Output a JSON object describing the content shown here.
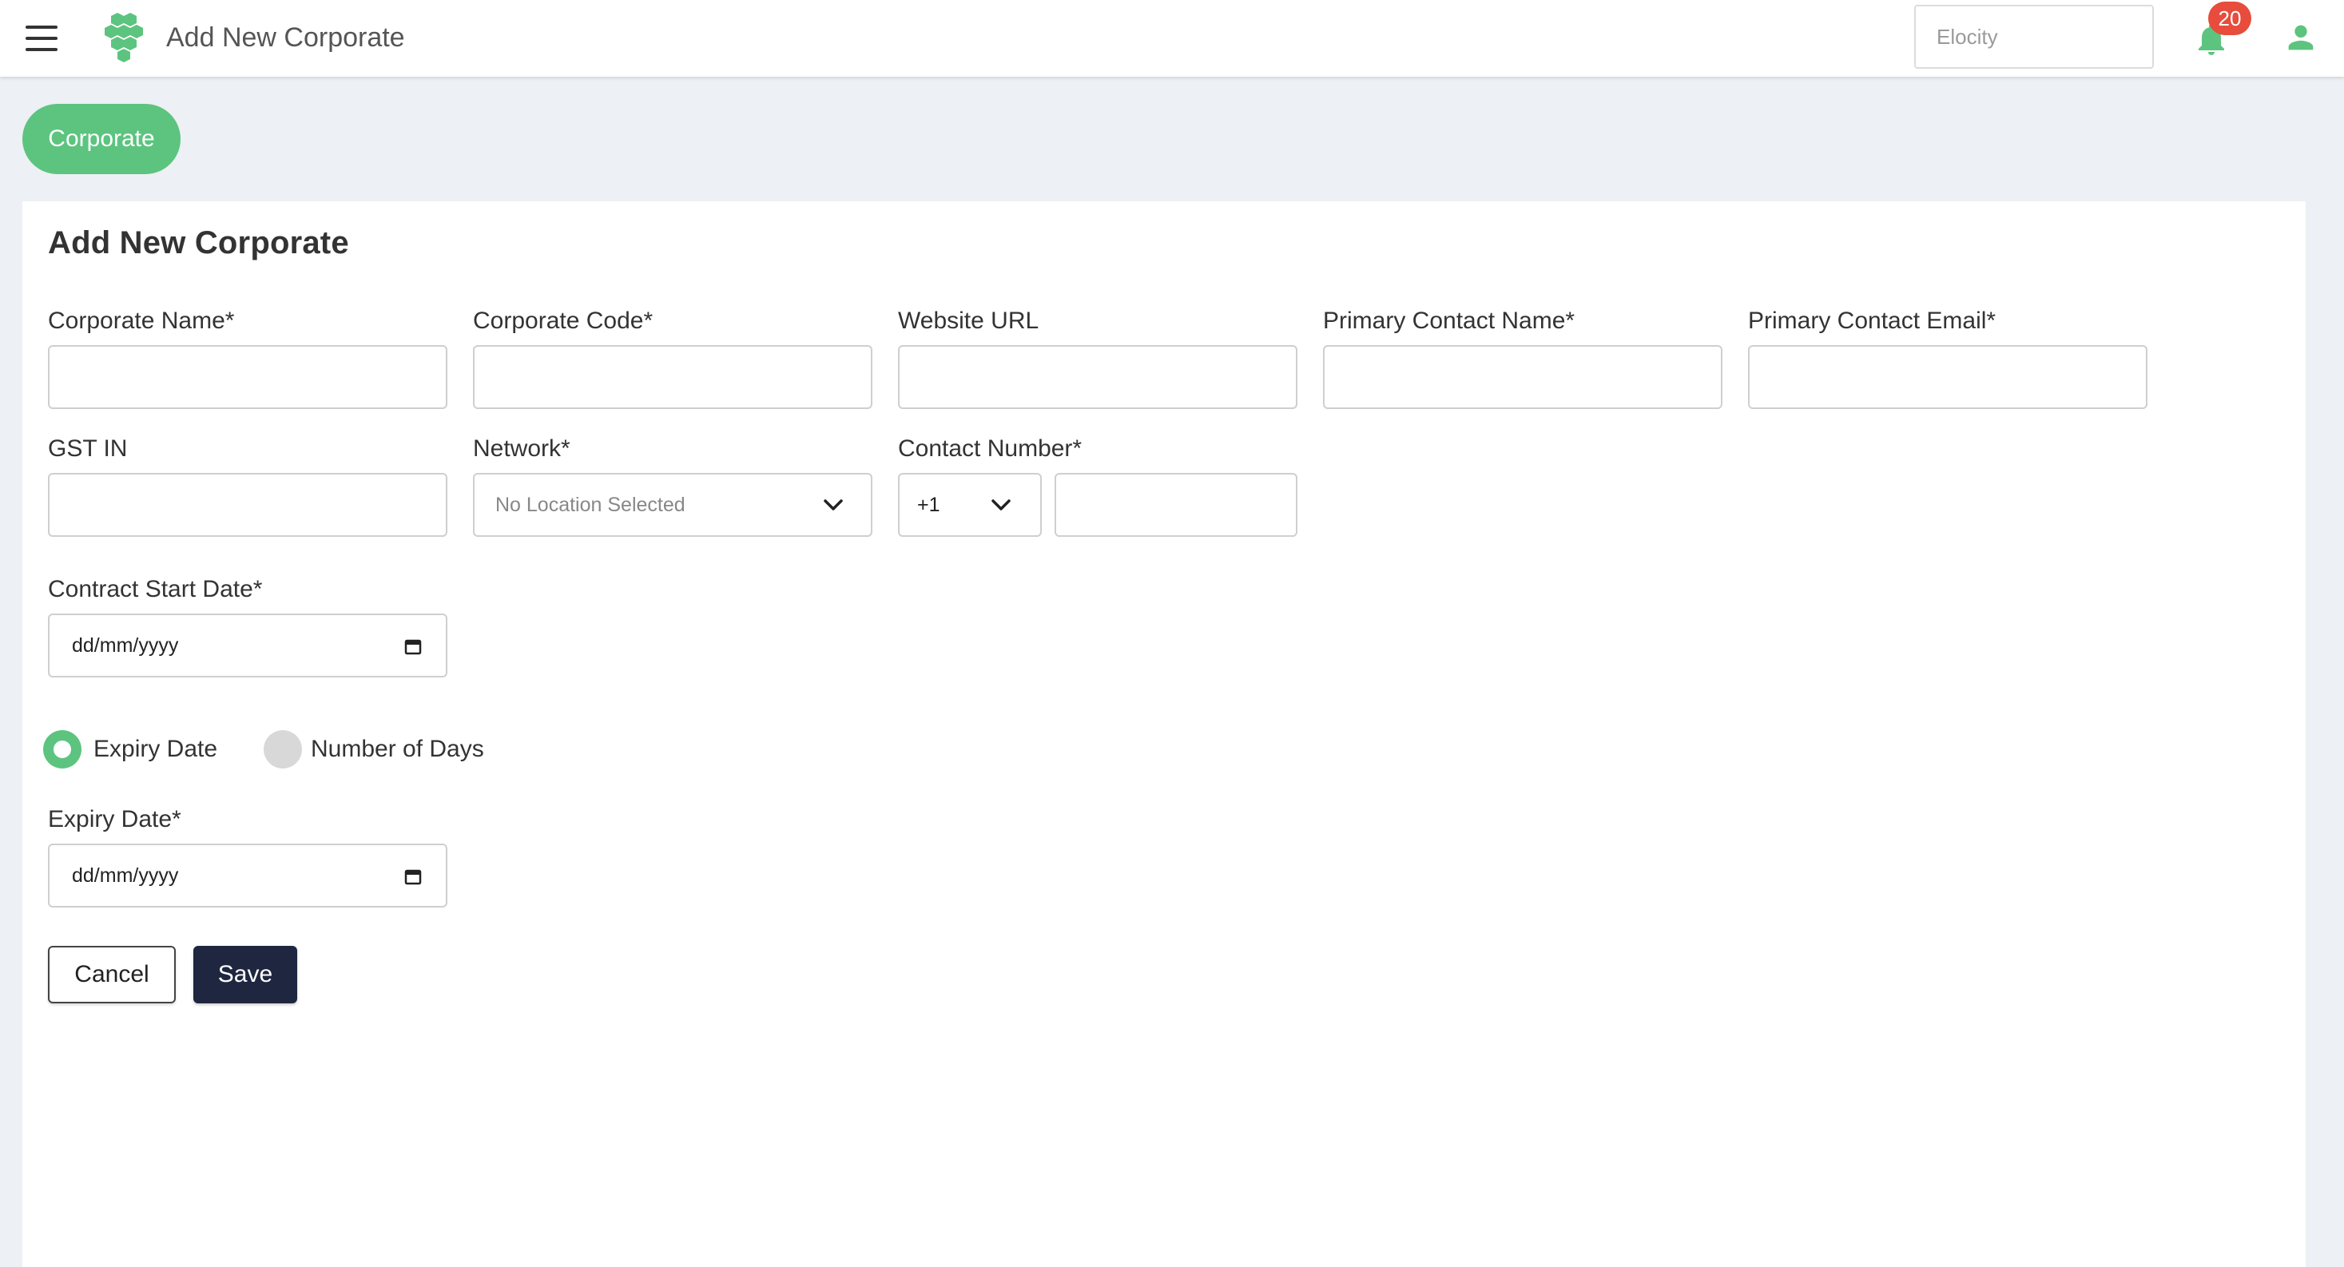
{
  "header": {
    "title": "Add New Corporate",
    "location_select": "Elocity",
    "notification_count": "20"
  },
  "tabs": [
    {
      "label": "Corporate",
      "active": true
    }
  ],
  "form": {
    "title": "Add New Corporate",
    "fields": {
      "corporate_name": {
        "label": "Corporate Name*",
        "value": ""
      },
      "corporate_code": {
        "label": "Corporate Code*",
        "value": ""
      },
      "website_url": {
        "label": "Website URL",
        "value": ""
      },
      "primary_contact_name": {
        "label": "Primary Contact Name*",
        "value": ""
      },
      "primary_contact_email": {
        "label": "Primary Contact Email*",
        "value": ""
      },
      "gst_in": {
        "label": "GST IN",
        "value": ""
      },
      "network": {
        "label": "Network*",
        "value": "No Location Selected"
      },
      "contact_number": {
        "label": "Contact Number*",
        "country_code": "+1",
        "value": ""
      },
      "contract_start_date": {
        "label": "Contract Start Date*",
        "placeholder": "dd/mm/yyyy"
      },
      "expiry_date": {
        "label": "Expiry Date*",
        "placeholder": "dd/mm/yyyy"
      }
    },
    "expiry_mode": {
      "options": [
        {
          "label": "Expiry Date",
          "selected": true
        },
        {
          "label": "Number of Days",
          "selected": false
        }
      ]
    },
    "buttons": {
      "cancel": "Cancel",
      "save": "Save"
    }
  },
  "colors": {
    "brand_green": "#5cc47f",
    "save_button": "#1f2640",
    "badge": "#e74c3c"
  }
}
